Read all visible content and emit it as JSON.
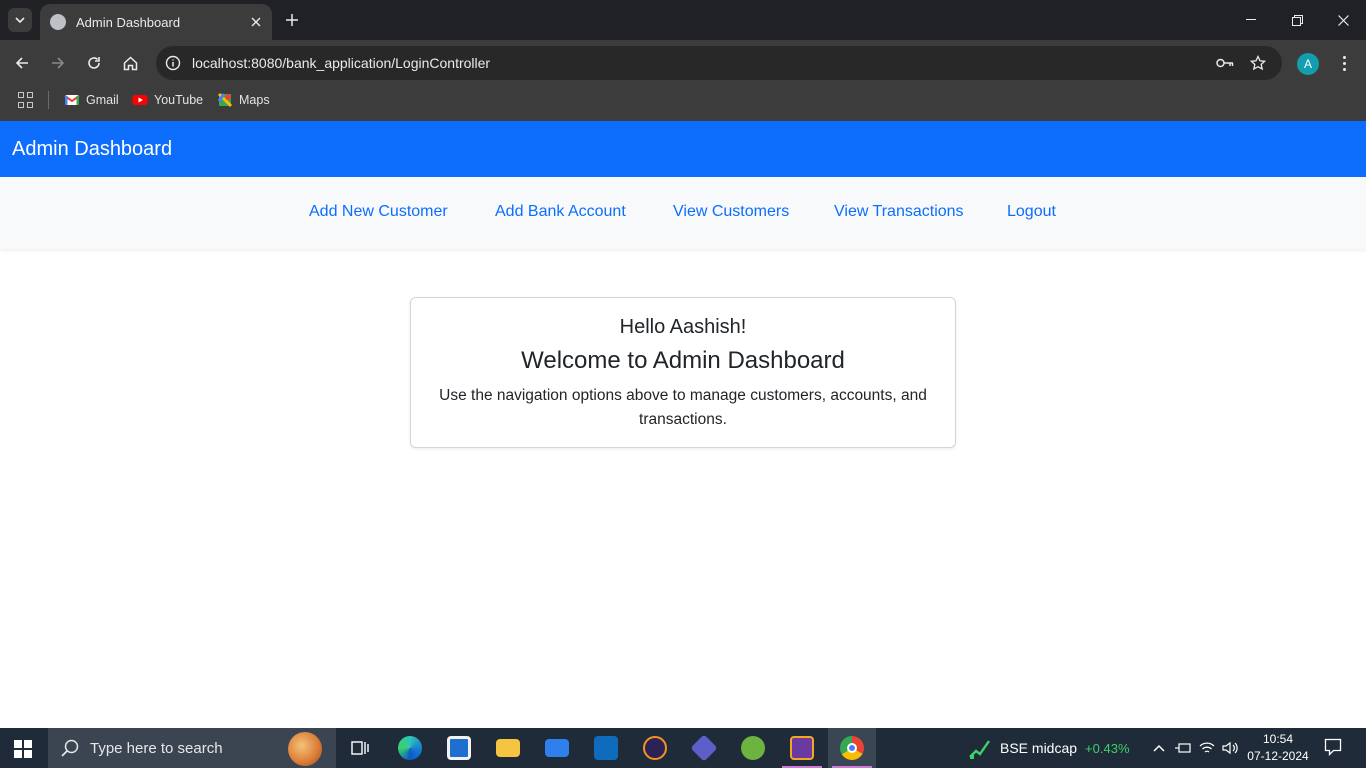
{
  "browser": {
    "tab_title": "Admin Dashboard",
    "url": "localhost:8080/bank_application/LoginController",
    "profile_initial": "A",
    "bookmarks": [
      {
        "label": "Gmail",
        "icon": "gmail-icon"
      },
      {
        "label": "YouTube",
        "icon": "youtube-icon"
      },
      {
        "label": "Maps",
        "icon": "maps-icon"
      }
    ]
  },
  "page": {
    "brand": "Admin Dashboard",
    "nav": [
      {
        "label": "Add New Customer"
      },
      {
        "label": "Add Bank Account"
      },
      {
        "label": "View Customers"
      },
      {
        "label": "View Transactions"
      },
      {
        "label": "Logout"
      }
    ],
    "card": {
      "greeting": "Hello Aashish!",
      "heading": "Welcome to Admin Dashboard",
      "description": "Use the navigation options above to manage customers, accounts, and transactions."
    },
    "colors": {
      "primary": "#0d6efd",
      "subnav_bg": "#f8f9fa"
    }
  },
  "taskbar": {
    "search_placeholder": "Type here to search",
    "stock_name": "BSE midcap",
    "stock_change": "+0.43%",
    "time": "10:54",
    "date": "07-12-2024"
  }
}
